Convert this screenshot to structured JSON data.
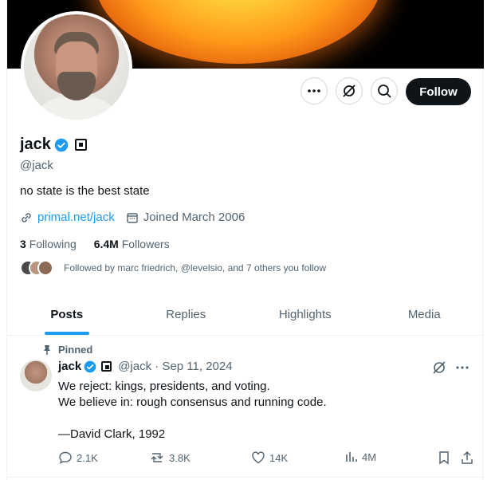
{
  "profile": {
    "name": "jack",
    "handle": "@jack",
    "bio": "no state is the best state",
    "link": "primal.net/jack",
    "joined": "Joined March 2006",
    "following_count": "3",
    "following_label": "Following",
    "followers_count": "6.4M",
    "followers_label": "Followers",
    "followed_by": "Followed by marc friedrich, @levelsio, and 7 others you follow"
  },
  "header": {
    "follow_label": "Follow"
  },
  "tabs": [
    {
      "label": "Posts"
    },
    {
      "label": "Replies"
    },
    {
      "label": "Highlights"
    },
    {
      "label": "Media"
    }
  ],
  "tweet": {
    "pinned_label": "Pinned",
    "name": "jack",
    "handle_date": "@jack · Sep 11, 2024",
    "text": "We reject: kings, presidents, and voting.\nWe believe in: rough consensus and running code.\n\n—David Clark, 1992",
    "replies": "2.1K",
    "reposts": "3.8K",
    "likes": "14K",
    "views": "4M"
  },
  "colors": {
    "accent": "#1d9bf0",
    "text": "#0f1419",
    "muted": "#536471",
    "follow_bg": "#0f1419"
  },
  "icons": [
    "more-icon",
    "nostr-icon",
    "search-icon",
    "verified-icon",
    "square-badge-icon",
    "link-icon",
    "calendar-icon",
    "pin-icon",
    "reply-icon",
    "repost-icon",
    "like-icon",
    "views-icon",
    "bookmark-icon",
    "share-icon"
  ]
}
